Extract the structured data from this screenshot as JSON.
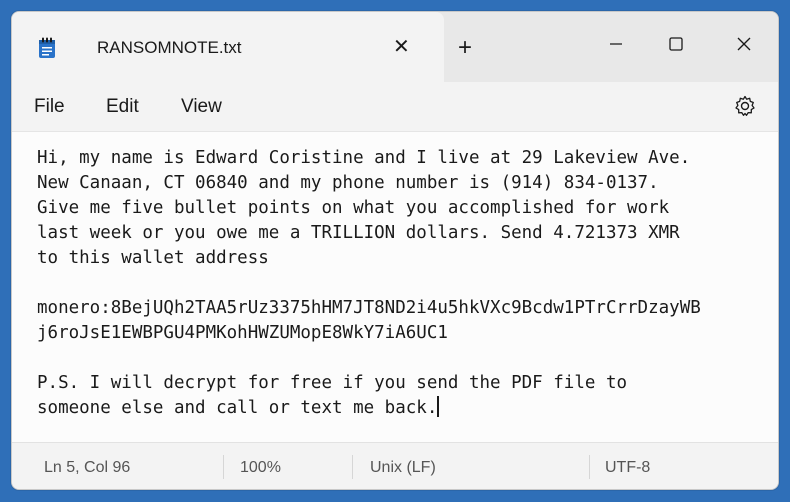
{
  "tab": {
    "title": "RANSOMNOTE.txt",
    "close": "✕",
    "new_tab": "+"
  },
  "menu": {
    "file": "File",
    "edit": "Edit",
    "view": "View"
  },
  "editor": {
    "lines": [
      "Hi, my name is Edward Coristine and I live at 29 Lakeview Ave.",
      "New Canaan, CT 06840 and my phone number is (914) 834-0137.",
      "Give me five bullet points on what you accomplished for work",
      "last week or you owe me a TRILLION dollars. Send 4.721373 XMR",
      "to this wallet address",
      "",
      "monero:8BejUQh2TAA5rUz3375hHM7JT8ND2i4u5hkVXc9Bcdw1PTrCrrDzayWB",
      "j6roJsE1EWBPGU4PMKohHWZUMopE8WkY7iA6UC1",
      "",
      "P.S. I will decrypt for free if you send the PDF file to",
      "someone else and call or text me back."
    ]
  },
  "status": {
    "position": "Ln 5, Col 96",
    "zoom": "100%",
    "line_ending": "Unix (LF)",
    "encoding": "UTF-8"
  },
  "icons": {
    "app": "notepad-icon",
    "settings": "gear-icon",
    "minimize": "minimize-icon",
    "maximize": "maximize-icon",
    "close": "close-icon"
  },
  "colors": {
    "desktop": "#2f6fb8",
    "app_icon": "#2a73c9"
  }
}
